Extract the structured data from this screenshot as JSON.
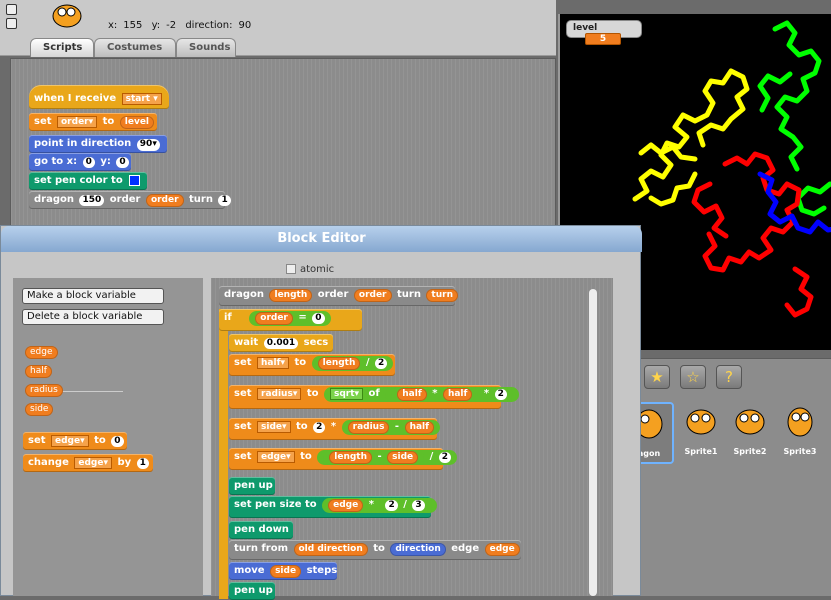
{
  "topbar": {
    "coords": {
      "x_label": "x:",
      "x": "155",
      "y_label": "y:",
      "y": "-2",
      "dir_label": "direction:",
      "dir": "90"
    },
    "tabs": [
      "Scripts",
      "Costumes",
      "Sounds"
    ],
    "active_tab": "Scripts"
  },
  "script": {
    "hat": {
      "label": "when I receive",
      "message": "start"
    },
    "set": {
      "label": "set",
      "var": "order",
      "to": "to",
      "value": "level"
    },
    "point": {
      "label": "point in direction",
      "value": "90"
    },
    "goto": {
      "label": "go to x:",
      "x": "0",
      "y_label": "y:",
      "y": "0"
    },
    "pencolor": {
      "label": "set pen color to",
      "color": "#0030ff"
    },
    "dragon": {
      "label": "dragon",
      "length": "150",
      "order_label": "order",
      "order": "order",
      "turn_label": "turn",
      "turn": "1"
    }
  },
  "stage": {
    "watcher": {
      "label": "level",
      "value": "5"
    }
  },
  "corral": {
    "sprites": [
      "Dragon",
      "Sprite1",
      "Sprite2",
      "Sprite3"
    ],
    "visible_names": [
      "agon",
      "Sprite1",
      "Sprite2",
      "Sprite3"
    ]
  },
  "editor": {
    "title": "Block Editor",
    "atomic": "atomic",
    "palette": {
      "make_var": "Make a block variable",
      "delete_var": "Delete a block variable",
      "vars": [
        "edge",
        "half",
        "radius",
        "side"
      ],
      "set": {
        "label": "set",
        "var": "edge",
        "to": "to",
        "value": "0"
      },
      "change": {
        "label": "change",
        "var": "edge",
        "by": "by",
        "value": "1"
      }
    },
    "def": {
      "name": "dragon",
      "p1": "length",
      "w1": "order",
      "p2": "order",
      "w2": "turn",
      "p3": "turn"
    },
    "if": {
      "label": "if",
      "var": "order",
      "op": "=",
      "value": "0"
    },
    "wait": {
      "label": "wait",
      "value": "0.001",
      "unit": "secs"
    },
    "set_half": {
      "label": "set",
      "var": "half",
      "to": "to",
      "a": "length",
      "op": "/",
      "b": "2"
    },
    "set_radius": {
      "label": "set",
      "var": "radius",
      "to": "to",
      "fn": "sqrt",
      "of": "of",
      "a": "half",
      "op1": "*",
      "b": "half",
      "op2": "*",
      "c": "2"
    },
    "set_side": {
      "label": "set",
      "var": "side",
      "to": "to",
      "a": "2",
      "op1": "*",
      "b": "radius",
      "op2": "-",
      "c": "half"
    },
    "set_edge": {
      "label": "set",
      "var": "edge",
      "to": "to",
      "a": "length",
      "op1": "-",
      "b": "side",
      "op2": "/",
      "c": "2"
    },
    "pen_up": "pen up",
    "pen_size": {
      "label": "set pen size to",
      "a": "edge",
      "op1": "*",
      "b": "2",
      "op2": "/",
      "c": "3"
    },
    "pen_down": "pen down",
    "turn_from": {
      "label": "turn from",
      "a": "old direction",
      "to": "to",
      "b": "direction",
      "edge_label": "edge",
      "c": "edge"
    },
    "move": {
      "label": "move",
      "var": "side",
      "steps": "steps"
    },
    "pen_up2": "pen up"
  }
}
